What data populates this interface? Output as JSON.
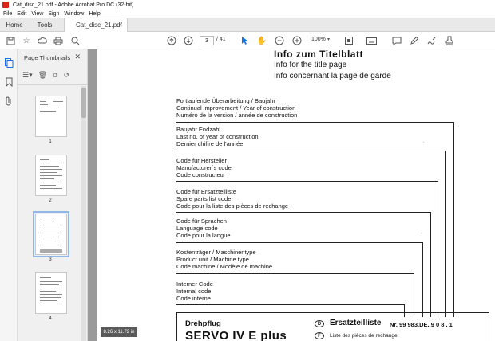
{
  "window": {
    "title": "Cat_disc_21.pdf - Adobe Acrobat Pro DC (32-bit)"
  },
  "menu": [
    "File",
    "Edit",
    "View",
    "Sign",
    "Window",
    "Help"
  ],
  "tabs": {
    "home": "Home",
    "tools": "Tools",
    "document": "Cat_disc_21.pdf",
    "close_glyph": "×"
  },
  "toolbar": {
    "current_page": "3",
    "page_count": "/ 41",
    "zoom": "100%"
  },
  "thumbnails": {
    "title": "Page Thumbnails",
    "pages": [
      "1",
      "2",
      "3",
      "4"
    ],
    "selected_page": "3",
    "page_size": "8.26 x 11.72 in"
  },
  "document": {
    "heading_de": "Info  zum  Titelblatt",
    "heading_en": "Info for the title page",
    "heading_fr": "Info concernant la page de garde",
    "groups": [
      {
        "lines": [
          "Fortlaufende Überarbeitung / Baujahr",
          "Continual improvement / Year of construction",
          "Numéro de la version / année de construction"
        ]
      },
      {
        "lines": [
          "Baujahr Endzahl",
          "Last no. of year of construction",
          "Dernier chiffre de l'année"
        ]
      },
      {
        "lines": [
          "Code für Hersteller",
          "Manufacturer´s  code",
          "Code constructeur"
        ]
      },
      {
        "lines": [
          "Code für Ersatzteilliste",
          "Spare parts list code",
          "Code pour la liste des pièces de rechange"
        ]
      },
      {
        "lines": [
          "Code für Sprachen",
          "Language code",
          "Code pour la langue"
        ]
      },
      {
        "lines": [
          "Kostenträger / Maschinentype",
          "Product unit / Machine type",
          "Code machine / Modèle de machine"
        ]
      },
      {
        "lines": [
          "Interner Code",
          "Internal code",
          "Code interne"
        ]
      }
    ],
    "box": {
      "machine_type": "Drehpflug",
      "machine_name": "SERVO IV E plus",
      "circle_d": "D",
      "circle_f": "F",
      "list_de": "Ersatzteilliste",
      "list_fr": "Liste des pièces de rechange",
      "number_label": "Nr. 99 983.DE. 9 0 8 . 1"
    }
  }
}
